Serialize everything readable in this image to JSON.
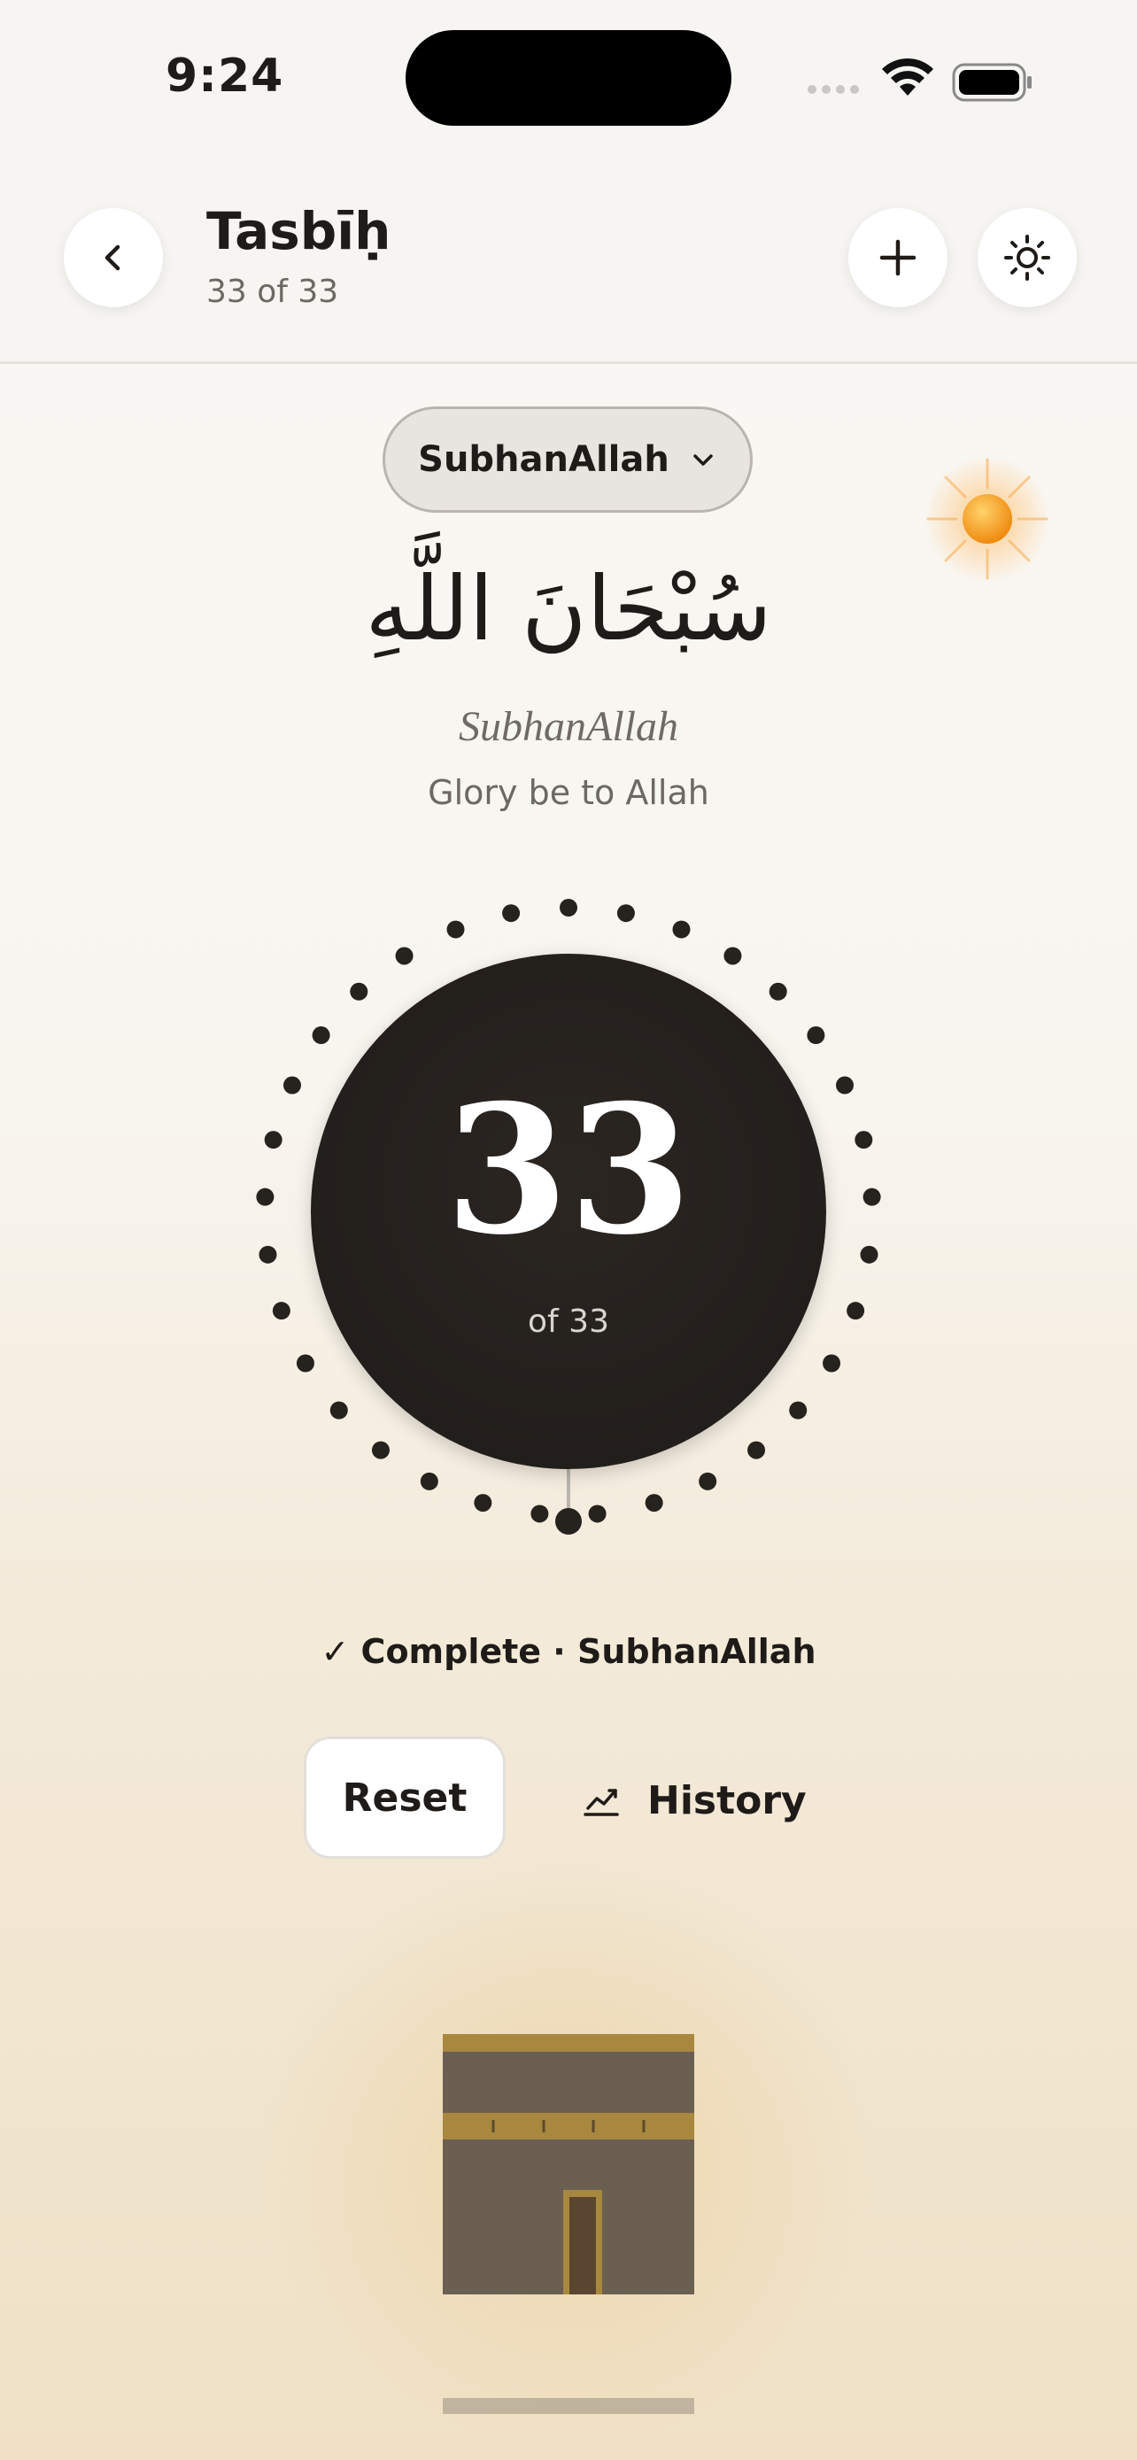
{
  "status_bar": {
    "time": "9:24"
  },
  "header": {
    "title": "Tasbīḥ",
    "subtitle": "33 of 33"
  },
  "dhikr_selector": {
    "label": "SubhanAllah"
  },
  "dhikr": {
    "arabic": "سُبْحَانَ اللَّهِ",
    "transliteration": "SubhanAllah",
    "translation": "Glory be to Allah"
  },
  "counter": {
    "count": "33",
    "of_label": "of 33",
    "progress": 1.0
  },
  "status": {
    "complete_text": "✓ Complete · SubhanAllah"
  },
  "actions": {
    "reset_label": "Reset",
    "history_label": "History"
  },
  "colors": {
    "ink": "#1e1b18",
    "bead": "#26221e",
    "gold": "#b08a3c",
    "sun": "#f39a1a"
  },
  "icons": [
    "chevron-left-icon",
    "plus-icon",
    "sun-icon",
    "chevron-down-icon",
    "chart-line-icon",
    "wifi-icon",
    "battery-icon",
    "cellular-icon"
  ]
}
